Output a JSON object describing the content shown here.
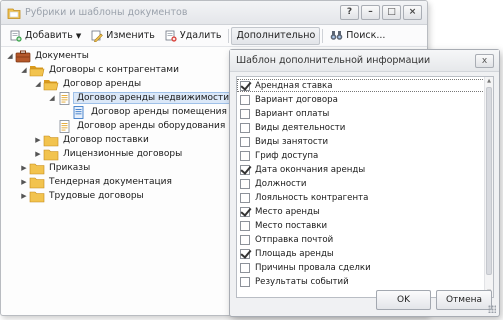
{
  "window": {
    "title": "Рубрики и шаблоны документов",
    "controls": [
      "?",
      "–",
      "□",
      "×"
    ]
  },
  "toolbar": {
    "add_label": "Добавить",
    "edit_label": "Изменить",
    "delete_label": "Удалить",
    "extra_label": "Дополнительно",
    "search_label": "Поиск..."
  },
  "tree": [
    {
      "label": "Документы",
      "level": 0,
      "expanded": true,
      "icon": "briefcase-icon"
    },
    {
      "label": "Договоры с контрагентами",
      "level": 1,
      "expanded": true,
      "icon": "folder-open-icon"
    },
    {
      "label": "Договор аренды",
      "level": 2,
      "expanded": true,
      "icon": "folder-open-icon"
    },
    {
      "label": "Договор аренды недвижимости",
      "level": 3,
      "expanded": true,
      "icon": "document-icon",
      "selected": true
    },
    {
      "label": "Договор аренды помещения",
      "level": 4,
      "icon": "document-blue-icon"
    },
    {
      "label": "Договор аренды оборудования",
      "level": 3,
      "icon": "document-icon"
    },
    {
      "label": "Договор поставки",
      "level": 2,
      "expanded": false,
      "icon": "folder-icon"
    },
    {
      "label": "Лицензионные договоры",
      "level": 2,
      "expanded": false,
      "icon": "folder-icon"
    },
    {
      "label": "Приказы",
      "level": 1,
      "expanded": false,
      "icon": "folder-icon"
    },
    {
      "label": "Тендерная документация",
      "level": 1,
      "expanded": false,
      "icon": "folder-icon"
    },
    {
      "label": "Трудовые договоры",
      "level": 1,
      "expanded": false,
      "icon": "folder-icon"
    }
  ],
  "dialog": {
    "title": "Шаблон дополнительной информации",
    "close": "x",
    "items": [
      {
        "label": "Арендная ставка",
        "checked": true
      },
      {
        "label": "Вариант договора",
        "checked": false
      },
      {
        "label": "Вариант оплаты",
        "checked": false
      },
      {
        "label": "Виды деятельности",
        "checked": false
      },
      {
        "label": "Виды занятости",
        "checked": false
      },
      {
        "label": "Гриф доступа",
        "checked": false
      },
      {
        "label": "Дата окончания аренды",
        "checked": true
      },
      {
        "label": "Должности",
        "checked": false
      },
      {
        "label": "Лояльность контрагента",
        "checked": false
      },
      {
        "label": "Место аренды",
        "checked": true
      },
      {
        "label": "Место поставки",
        "checked": false
      },
      {
        "label": "Отправка почтой",
        "checked": false
      },
      {
        "label": "Площадь аренды",
        "checked": true
      },
      {
        "label": "Причины провала сделки",
        "checked": false
      },
      {
        "label": "Результаты событий",
        "checked": false
      }
    ],
    "ok_label": "OK",
    "cancel_label": "Отмена"
  },
  "colors": {
    "folder": "#f2c34e",
    "folder_dark": "#d99a1e",
    "selection": "#dbe8f8",
    "accent_blue": "#3d7cc9"
  }
}
